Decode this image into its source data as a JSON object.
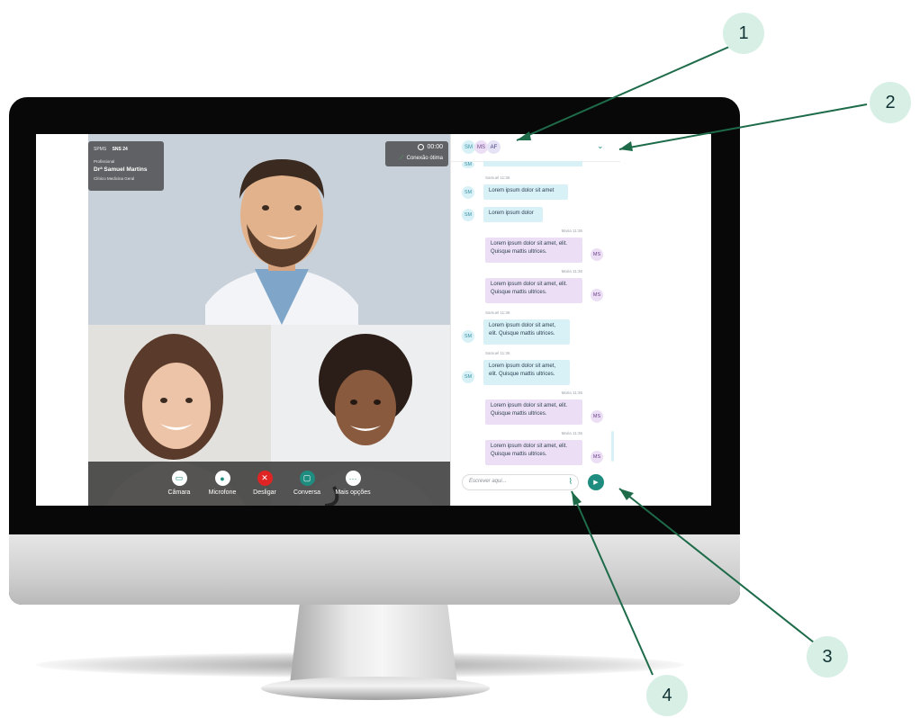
{
  "professional": {
    "logos": [
      "SPMS",
      "SNS 24"
    ],
    "role": "Profissional",
    "name": "Drª Samuel Martins",
    "specialty": "Clínico Medicina Geral"
  },
  "call_status": {
    "timer": "00:00",
    "connection": "Conexão ótima"
  },
  "controls": [
    {
      "label": "Câmara",
      "icon": "camera-icon",
      "color": "#ffffff"
    },
    {
      "label": "Microfone",
      "icon": "microphone-icon",
      "color": "#ffffff"
    },
    {
      "label": "Desligar",
      "icon": "hang-up-icon",
      "color": "#e02424"
    },
    {
      "label": "Conversa",
      "icon": "chat-icon",
      "color": "#1e8c7e"
    },
    {
      "label": "Mais opções",
      "icon": "more-options-icon",
      "color": "#ffffff"
    }
  ],
  "chat": {
    "participants": [
      "SM",
      "MS",
      "AF"
    ],
    "messages": [
      {
        "sender": "Samuel 11:36",
        "avatar": "SM",
        "side": "in",
        "text": "Lorem ipsum dolor sit amet"
      },
      {
        "sender": "",
        "avatar": "SM",
        "side": "in",
        "text": "Lorem ipsum dolor"
      },
      {
        "sender": "Maria 11:36",
        "avatar": "MS",
        "side": "out",
        "text": "Lorem ipsum dolor sit amet, elit. Quisque mattis ultrices."
      },
      {
        "sender": "Maria 11:36",
        "avatar": "MS",
        "side": "out",
        "text": "Lorem ipsum dolor sit amet, elit. Quisque mattis ultrices."
      },
      {
        "sender": "Samuel 11:36",
        "avatar": "SM",
        "side": "in",
        "text": "Lorem ipsum dolor sit amet, elit. Quisque mattis ultrices."
      },
      {
        "sender": "Samuel 11:36",
        "avatar": "SM",
        "side": "in",
        "text": "Lorem ipsum dolor sit amet, elit. Quisque mattis ultrices."
      },
      {
        "sender": "Maria 11:36",
        "avatar": "MS",
        "side": "out",
        "text": "Lorem ipsum dolor sit amet, elit. Quisque mattis ultrices."
      },
      {
        "sender": "Maria 11:36",
        "avatar": "MS",
        "side": "out",
        "text": "Lorem ipsum dolor sit amet, elit. Quisque mattis ultrices."
      }
    ],
    "input_placeholder": "Escrever aqui..."
  },
  "callouts": [
    "1",
    "2",
    "3",
    "4"
  ],
  "colors": {
    "accent": "#1e8c7e",
    "callout_bg": "#d8efe6",
    "incoming_bubble": "#d7f1f7",
    "outgoing_bubble": "#ecdff5",
    "hangup": "#e02424"
  }
}
